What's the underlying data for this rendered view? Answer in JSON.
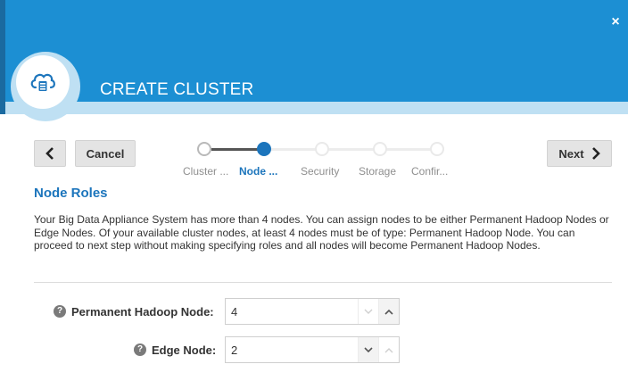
{
  "header": {
    "title": "CREATE CLUSTER",
    "close_symbol": "×"
  },
  "colors": {
    "header_blue": "#1c8fd3",
    "accent": "#1c75bc"
  },
  "nav": {
    "back_symbol": "<",
    "cancel_label": "Cancel",
    "next_label": "Next"
  },
  "train": {
    "steps": [
      {
        "label": "Cluster ...",
        "state": "done"
      },
      {
        "label": "Node ...",
        "state": "active"
      },
      {
        "label": "Security",
        "state": "todo"
      },
      {
        "label": "Storage",
        "state": "todo"
      },
      {
        "label": "Confir...",
        "state": "todo"
      }
    ]
  },
  "section": {
    "title": "Node Roles",
    "description": "Your Big Data Appliance System has more than 4 nodes. You can assign nodes to be either Permanent Hadoop Nodes or Edge Nodes. Of your available cluster nodes, at least 4 nodes must be of type: Permanent Hadoop Node. You can proceed to next step without making specifying roles and all nodes will become Permanent Hadoop Nodes."
  },
  "fields": {
    "permanent_hadoop": {
      "label": "Permanent Hadoop Node:",
      "value": "4"
    },
    "edge": {
      "label": "Edge Node:",
      "value": "2"
    }
  },
  "help_symbol": "?"
}
